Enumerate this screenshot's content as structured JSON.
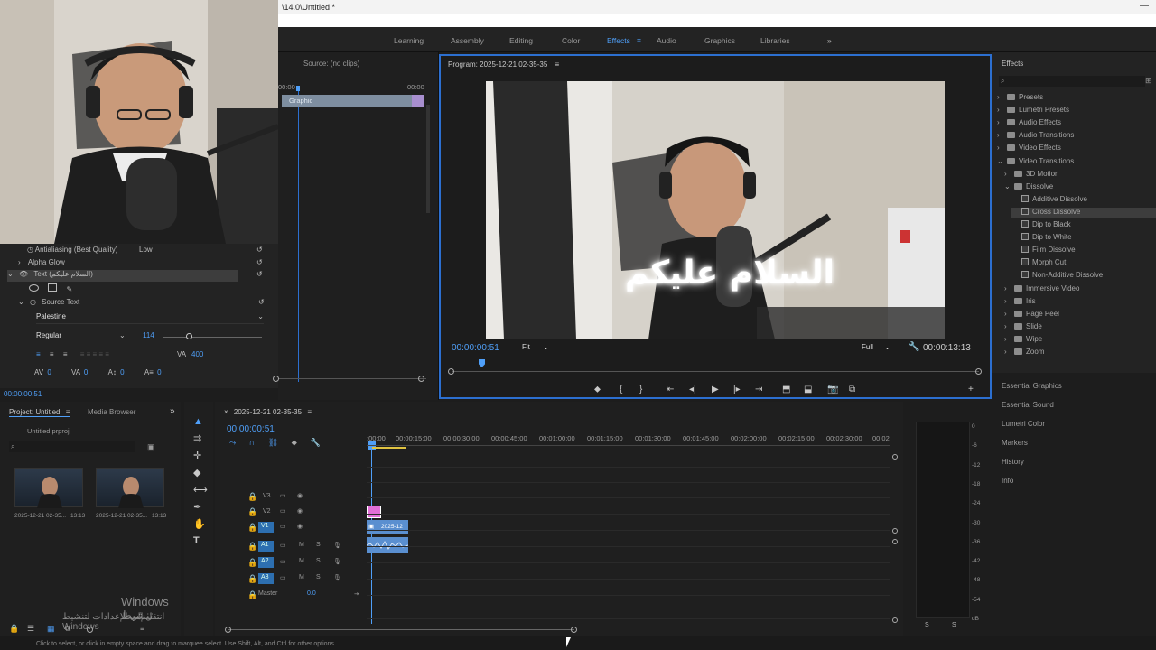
{
  "titlebar": {
    "title": "\\14.0\\Untitled *"
  },
  "workspaces": [
    "Learning",
    "Assembly",
    "Editing",
    "Color",
    "Effects",
    "Audio",
    "Graphics",
    "Libraries"
  ],
  "workspace_active": "Effects",
  "source": {
    "title": "Source: (no clips)",
    "tc_left": "00:00",
    "tc_right": "00:00",
    "clip": "Graphic"
  },
  "effect_controls": {
    "antialiasing": "Antialiasing (Best Quality)",
    "antialiasing_value": "Low",
    "alpha_glow": "Alpha Glow",
    "text_layer": "Text (السلام عليكم)",
    "source_text": "Source Text",
    "font": "Palestine",
    "style": "Regular",
    "size": "114",
    "tracking": "400",
    "timecode": "00:00:00:51",
    "val0a": "0",
    "val0b": "0",
    "val0c": "0",
    "val0d": "0"
  },
  "program": {
    "title": "Program: 2025-12-21 02-35-35",
    "current_tc": "00:00:00:51",
    "fit": "Fit",
    "quality": "Full",
    "duration": "00:00:13:13",
    "caption": "السلام عليكم"
  },
  "effects_panel": {
    "title": "Effects",
    "tree": [
      {
        "label": "Presets",
        "indent": 0,
        "type": "folder"
      },
      {
        "label": "Lumetri Presets",
        "indent": 0,
        "type": "folder"
      },
      {
        "label": "Audio Effects",
        "indent": 0,
        "type": "folder"
      },
      {
        "label": "Audio Transitions",
        "indent": 0,
        "type": "folder"
      },
      {
        "label": "Video Effects",
        "indent": 0,
        "type": "folder"
      },
      {
        "label": "Video Transitions",
        "indent": 0,
        "type": "folder",
        "open": true
      },
      {
        "label": "3D Motion",
        "indent": 1,
        "type": "folder"
      },
      {
        "label": "Dissolve",
        "indent": 1,
        "type": "folder",
        "open": true
      },
      {
        "label": "Additive Dissolve",
        "indent": 2,
        "type": "fx"
      },
      {
        "label": "Cross Dissolve",
        "indent": 2,
        "type": "fx",
        "selected": true
      },
      {
        "label": "Dip to Black",
        "indent": 2,
        "type": "fx"
      },
      {
        "label": "Dip to White",
        "indent": 2,
        "type": "fx"
      },
      {
        "label": "Film Dissolve",
        "indent": 2,
        "type": "fx"
      },
      {
        "label": "Morph Cut",
        "indent": 2,
        "type": "fx"
      },
      {
        "label": "Non-Additive Dissolve",
        "indent": 2,
        "type": "fx"
      },
      {
        "label": "Immersive Video",
        "indent": 1,
        "type": "folder"
      },
      {
        "label": "Iris",
        "indent": 1,
        "type": "folder"
      },
      {
        "label": "Page Peel",
        "indent": 1,
        "type": "folder"
      },
      {
        "label": "Slide",
        "indent": 1,
        "type": "folder"
      },
      {
        "label": "Wipe",
        "indent": 1,
        "type": "folder"
      },
      {
        "label": "Zoom",
        "indent": 1,
        "type": "folder"
      }
    ],
    "side_panels": [
      "Essential Graphics",
      "Essential Sound",
      "Lumetri Color",
      "Markers",
      "History",
      "Info"
    ]
  },
  "project": {
    "tab_project": "Project: Untitled",
    "tab_media": "Media Browser",
    "file": "Untitled.prproj",
    "items": [
      {
        "name": "2025-12-21 02-35...",
        "duration": "13:13"
      },
      {
        "name": "2025-12-21 02-35...",
        "duration": "13:13"
      }
    ]
  },
  "timeline": {
    "seq_name": "2025-12-21 02-35-35",
    "timecode": "00:00:00:51",
    "ruler": [
      ":00:00",
      "00:00:15:00",
      "00:00:30:00",
      "00:00:45:00",
      "00:01:00:00",
      "00:01:15:00",
      "00:01:30:00",
      "00:01:45:00",
      "00:02:00:00",
      "00:02:15:00",
      "00:02:30:00",
      "00:02"
    ],
    "video_tracks": [
      "V3",
      "V2",
      "V1"
    ],
    "audio_tracks": [
      "A1",
      "A2",
      "A3"
    ],
    "master": "Master",
    "master_val": "0.0",
    "clip_v1": "2025-12",
    "m": "M",
    "s": "S"
  },
  "meter": {
    "scale": [
      "0",
      "-6",
      "-12",
      "-18",
      "-24",
      "-30",
      "-36",
      "-42",
      "-48",
      "-54",
      "dB"
    ],
    "s1": "S",
    "s2": "S"
  },
  "watermark": {
    "line1": "Windows تنشيط",
    "line2": "انتقل إلى الإعدادات لتنشيط Windows"
  },
  "status": "Click to select, or click in empty space and drag to marquee select. Use Shift, Alt, and Ctrl for other options.",
  "colors": {
    "accent": "#4f9ff8",
    "panel": "#232323",
    "selection": "#3d3d3d",
    "program_border": "#2c6fd0"
  }
}
